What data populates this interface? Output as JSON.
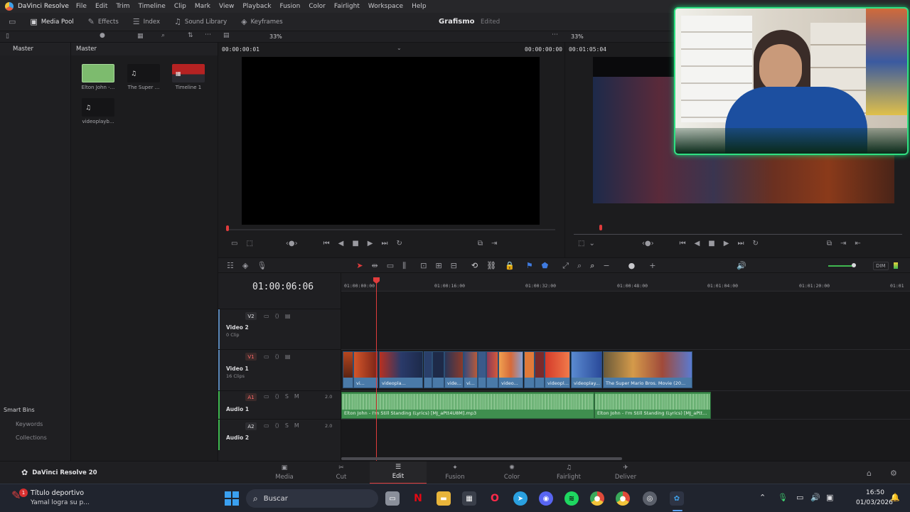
{
  "app": {
    "name": "DaVinci Resolve",
    "menu": [
      "File",
      "Edit",
      "Trim",
      "Timeline",
      "Clip",
      "Mark",
      "View",
      "Playback",
      "Fusion",
      "Color",
      "Fairlight",
      "Workspace",
      "Help"
    ]
  },
  "toolbar": {
    "media_pool": "Media Pool",
    "effects": "Effects",
    "index": "Index",
    "sound_library": "Sound Library",
    "keyframes": "Keyframes",
    "project_title": "Grafismo",
    "project_status": "Edited"
  },
  "subbar": {
    "zoom_left": "33%",
    "zoom_right": "33%"
  },
  "bins": {
    "master": "Master",
    "smart_bins": "Smart Bins",
    "keywords": "Keywords",
    "collections": "Collections"
  },
  "media_pool": {
    "header": "Master",
    "clips": [
      {
        "label": "Elton John -...",
        "kind": "audio"
      },
      {
        "label": "The Super ...",
        "kind": "audio"
      },
      {
        "label": "Timeline 1",
        "kind": "timeline"
      },
      {
        "label": "videoplayb...",
        "kind": "audio"
      }
    ]
  },
  "source_viewer": {
    "timecode_left": "00:00:00:01",
    "timecode_right": "00:00:00:00"
  },
  "record_viewer": {
    "timecode": "00:01:05:04"
  },
  "timeline": {
    "timecode": "01:00:06:06",
    "ruler": [
      "01:00:00:00",
      "01:00:16:00",
      "01:00:32:00",
      "01:00:48:00",
      "01:01:04:00",
      "01:01:20:00",
      "01:01"
    ],
    "volume_dim": "DIM",
    "tracks": [
      {
        "id": "V2",
        "name": "Video 2",
        "sub": "0 Clip"
      },
      {
        "id": "V1",
        "name": "Video 1",
        "sub": "16 Clips"
      },
      {
        "id": "A1",
        "name": "Audio 1",
        "channels": "2.0",
        "s": "S",
        "m": "M"
      },
      {
        "id": "A2",
        "name": "Audio 2",
        "channels": "2.0",
        "s": "S",
        "m": "M"
      }
    ],
    "video_clips": [
      "vi...",
      "videopla...",
      "vide...",
      "vi...",
      "video...",
      "videopl...",
      "videoplay...",
      "The Super Mario Bros. Movie (20..."
    ],
    "audio_clips": [
      "Elton John - I'm Still Standing (Lyrics) [MJ_aPtt4U8M].mp3",
      "Elton John - I'm Still Standing (Lyrics) [MJ_aPtt..."
    ]
  },
  "pages": {
    "brand": "DaVinci Resolve 20",
    "tabs": [
      "Media",
      "Cut",
      "Edit",
      "Fusion",
      "Color",
      "Fairlight",
      "Deliver"
    ],
    "active": "Edit"
  },
  "taskbar": {
    "notification_title": "Título deportivo",
    "notification_body": "Yamal logra su p...",
    "notification_count": "1",
    "search_placeholder": "Buscar",
    "time": "16:50",
    "date": "01/03/2026"
  },
  "colors": {
    "accent_red": "#e03c3c",
    "video_clip": "#4a7aa8",
    "audio_clip": "#3f8f4f",
    "webcam_border": "#2fe082"
  }
}
